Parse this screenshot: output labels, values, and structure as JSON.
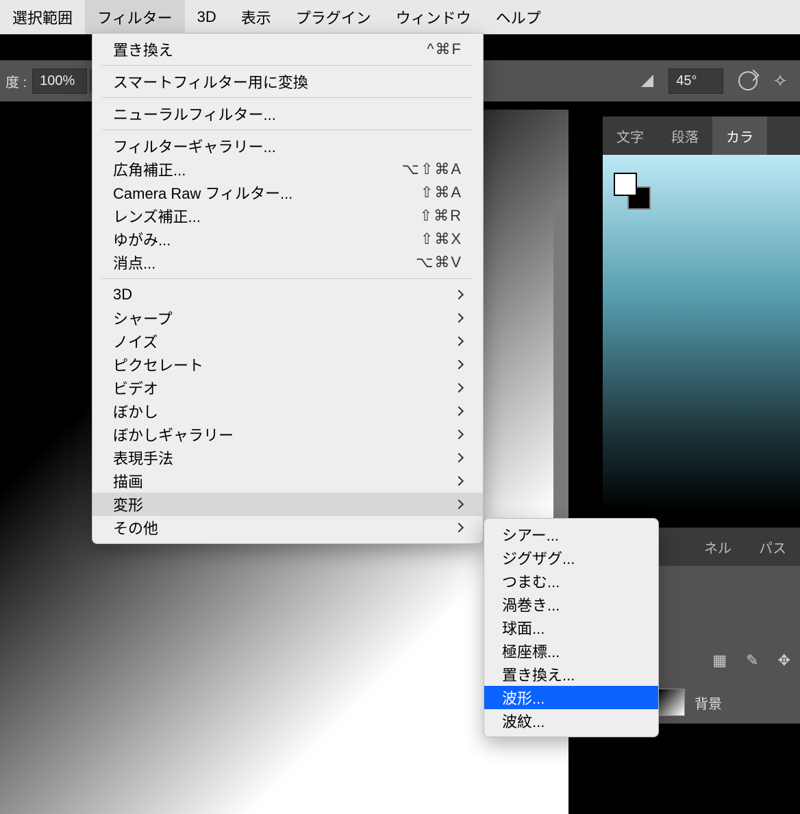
{
  "menubar": {
    "items": [
      {
        "label": "選択範囲"
      },
      {
        "label": "フィルター",
        "active": true
      },
      {
        "label": "3D"
      },
      {
        "label": "表示"
      },
      {
        "label": "プラグイン"
      },
      {
        "label": "ウィンドウ"
      },
      {
        "label": "ヘルプ"
      }
    ]
  },
  "optionbar": {
    "degree_label": "度 :",
    "degree_value": "100%",
    "angle_value": "45°"
  },
  "panel_tabs": {
    "a": "文字",
    "b": "段落",
    "c": "カラ"
  },
  "panel2_tabs": {
    "a": "ネル",
    "b": "パス"
  },
  "layer": {
    "name": "背景"
  },
  "dropdown": {
    "last_filter": {
      "label": "置き換え",
      "shortcut": "^⌘F"
    },
    "smart": "スマートフィルター用に変換",
    "neural": "ニューラルフィルター...",
    "gallery": "フィルターギャラリー...",
    "wide": {
      "label": "広角補正...",
      "shortcut": "⌥⇧⌘A"
    },
    "camera_raw": {
      "label": "Camera Raw フィルター...",
      "shortcut": "⇧⌘A"
    },
    "lens": {
      "label": "レンズ補正...",
      "shortcut": "⇧⌘R"
    },
    "liquify": {
      "label": "ゆがみ...",
      "shortcut": "⇧⌘X"
    },
    "vanish": {
      "label": "消点...",
      "shortcut": "⌥⌘V"
    },
    "subs": [
      "3D",
      "シャープ",
      "ノイズ",
      "ピクセレート",
      "ビデオ",
      "ぼかし",
      "ぼかしギャラリー",
      "表現手法",
      "描画",
      "変形",
      "その他"
    ]
  },
  "submenu": {
    "items": [
      "シアー...",
      "ジグザグ...",
      "つまむ...",
      "渦巻き...",
      "球面...",
      "極座標...",
      "置き換え...",
      "波形...",
      "波紋..."
    ],
    "selected_index": 7
  }
}
